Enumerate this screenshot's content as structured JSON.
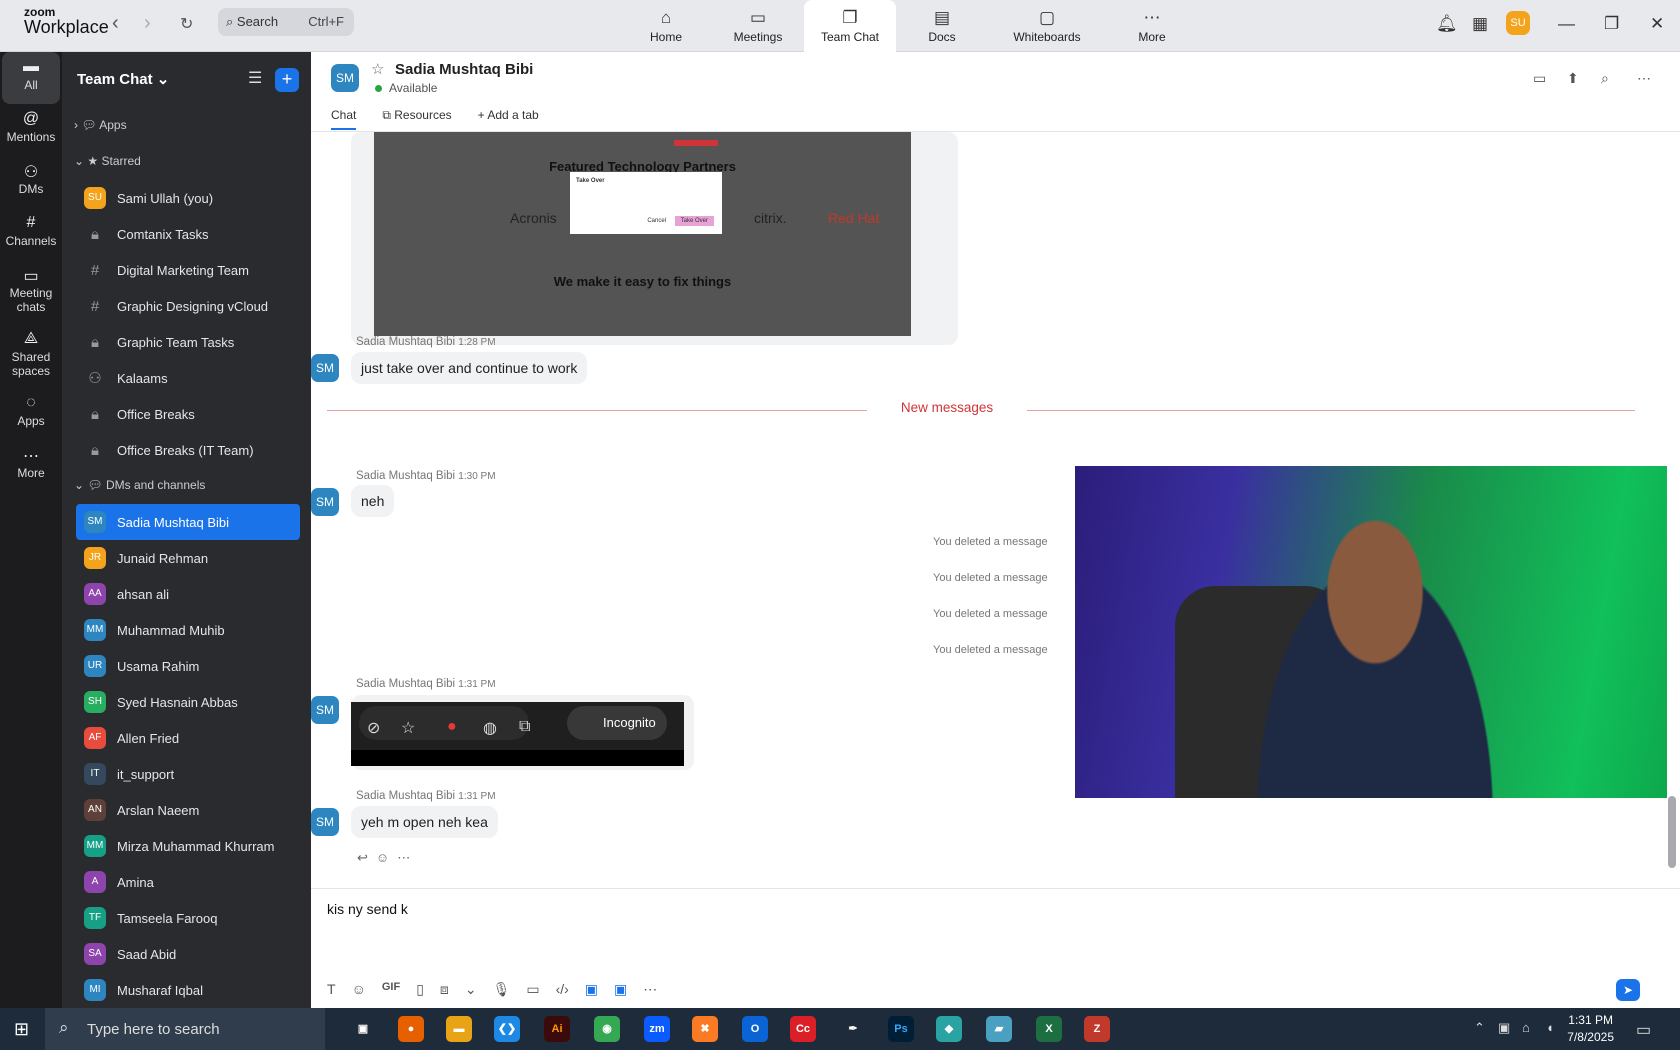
{
  "app": {
    "logo_line1": "zoom",
    "logo_line2": "Workplace"
  },
  "search": {
    "label": "Search",
    "shortcut": "Ctrl+F"
  },
  "topnav": [
    {
      "label": "Home",
      "icon": "home-icon"
    },
    {
      "label": "Meetings",
      "icon": "video-icon"
    },
    {
      "label": "Team Chat",
      "icon": "chat-icon"
    },
    {
      "label": "Docs",
      "icon": "doc-icon"
    },
    {
      "label": "Whiteboards",
      "icon": "whiteboard-icon"
    },
    {
      "label": "More",
      "icon": "more-icon"
    }
  ],
  "user": {
    "initials": "SU"
  },
  "rail": [
    {
      "label": "All",
      "icon": "chat-icon"
    },
    {
      "label": "Mentions",
      "icon": "at-icon"
    },
    {
      "label": "DMs",
      "icon": "people-icon"
    },
    {
      "label": "Channels",
      "icon": "hash-icon"
    },
    {
      "label": "Meeting chats",
      "icon": "calendar-icon"
    },
    {
      "label": "Shared spaces",
      "icon": "share-icon"
    },
    {
      "label": "Apps",
      "icon": "apps-icon"
    },
    {
      "label": "More",
      "icon": "more-icon"
    }
  ],
  "sidebar": {
    "title": "Team Chat",
    "sections": {
      "apps": "Apps",
      "starred": "Starred",
      "dms": "DMs and channels"
    },
    "starred": [
      {
        "label": "Sami Ullah (you)",
        "initials": "SU",
        "color": "#f3a31c",
        "kind": "avatar"
      },
      {
        "label": "Comtanix Tasks",
        "kind": "lock"
      },
      {
        "label": "Digital Marketing Team",
        "kind": "hash"
      },
      {
        "label": "Graphic Designing vCloud",
        "kind": "hash"
      },
      {
        "label": "Graphic Team Tasks",
        "kind": "lock"
      },
      {
        "label": "Kalaams",
        "kind": "group"
      },
      {
        "label": "Office Breaks",
        "kind": "lock"
      },
      {
        "label": "Office Breaks (IT Team)",
        "kind": "lock"
      }
    ],
    "dms": [
      {
        "label": "Sadia Mushtaq Bibi",
        "initials": "SM",
        "color": "#2e86c1"
      },
      {
        "label": "Junaid Rehman",
        "initials": "JR",
        "color": "#f3a31c"
      },
      {
        "label": "ahsan ali",
        "initials": "AA",
        "color": "#8e44ad"
      },
      {
        "label": "Muhammad Muhib",
        "initials": "MM",
        "color": "#2e86c1"
      },
      {
        "label": "Usama Rahim",
        "initials": "UR",
        "color": "#2e86c1"
      },
      {
        "label": "Syed Hasnain Abbas",
        "initials": "SH",
        "color": "#27ae60"
      },
      {
        "label": "Allen Fried",
        "initials": "AF",
        "color": "#e74c3c"
      },
      {
        "label": "it_support",
        "initials": "IT",
        "color": "#34495e"
      },
      {
        "label": "Arslan Naeem",
        "initials": "AN",
        "color": "#5d4037"
      },
      {
        "label": "Mirza Muhammad Khurram",
        "initials": "MM",
        "color": "#16a085"
      },
      {
        "label": "Amina",
        "initials": "A",
        "color": "#8e44ad"
      },
      {
        "label": "Tamseela Farooq",
        "initials": "TF",
        "color": "#16a085"
      },
      {
        "label": "Saad Abid",
        "initials": "SA",
        "color": "#8e44ad"
      },
      {
        "label": "Musharaf Iqbal",
        "initials": "MI",
        "color": "#2e86c1"
      }
    ]
  },
  "chat": {
    "name": "Sadia Mushtaq Bibi",
    "initials": "SM",
    "status": "Available",
    "tabs": [
      "Chat",
      "Resources",
      "Add a tab"
    ],
    "new_messages": "New messages",
    "screenshot": {
      "heading1": "Featured Technology Partners",
      "heading2": "We make it easy to fix things",
      "logos": [
        "Acronis",
        "citrix.",
        "Red Hat"
      ],
      "dialog_title": "Take Over",
      "dialog_btn": "Take Over",
      "dialog_cancel": "Cancel"
    },
    "messages": [
      {
        "sender": "Sadia Mushtaq Bibi",
        "time": "1:28 PM",
        "text": "just take over and continue to work"
      },
      {
        "sender": "Sadia Mushtaq Bibi",
        "time": "1:30 PM",
        "text": "neh"
      },
      {
        "sender": "Sadia Mushtaq Bibi",
        "time": "1:31 PM",
        "text": ""
      },
      {
        "sender": "Sadia Mushtaq Bibi",
        "time": "1:31 PM",
        "text": "yeh m open neh kea"
      }
    ],
    "deleted": [
      "You deleted a message",
      "You deleted a message",
      "You deleted a message",
      "You deleted a message"
    ],
    "chrome_label": "Incognito",
    "compose_text": "kis ny send k"
  },
  "taskbar": {
    "search": "Type here to search",
    "time": "1:31 PM",
    "date": "7/8/2025"
  }
}
